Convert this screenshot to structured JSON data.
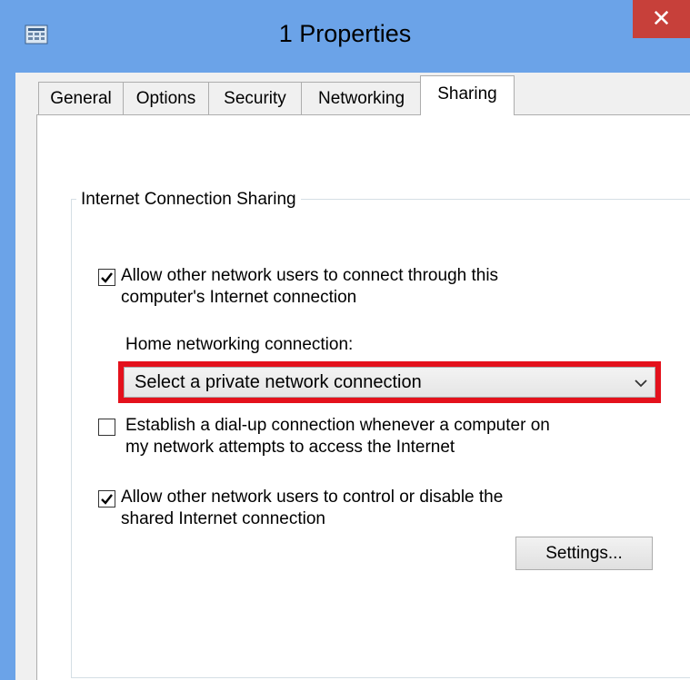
{
  "window": {
    "title": "1 Properties",
    "close_symbol": "✕",
    "app_icon": "network-adapter-icon",
    "colors": {
      "frame": "#6ba3e8",
      "close": "#c7403a",
      "highlight": "#e4111c"
    }
  },
  "tabs": [
    {
      "label": "General",
      "active": false
    },
    {
      "label": "Options",
      "active": false
    },
    {
      "label": "Security",
      "active": false
    },
    {
      "label": "Networking",
      "active": false
    },
    {
      "label": "Sharing",
      "active": true
    }
  ],
  "sharing": {
    "group_label": "Internet Connection Sharing",
    "allow_connect": {
      "checked": true,
      "line1": "Allow other network users to connect through this",
      "line2": "computer's Internet connection"
    },
    "home_label": "Home networking connection:",
    "home_select": {
      "value": "Select a private network connection",
      "arrow_icon": "chevron-down-icon"
    },
    "dialup": {
      "checked": false,
      "line1": "Establish a dial-up connection whenever a computer on",
      "line2": "my network attempts to access the Internet"
    },
    "allow_control": {
      "checked": true,
      "line1": "Allow other network users to control or disable the",
      "line2": "shared Internet connection"
    },
    "settings_button": "Settings..."
  }
}
